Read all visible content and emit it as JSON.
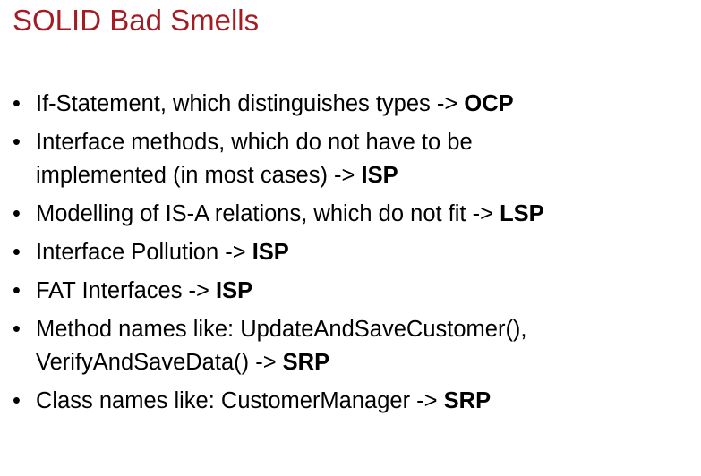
{
  "title": "SOLID Bad Smells",
  "title_color": "#a31c23",
  "bullet_icon": "bullet-dot",
  "items": [
    {
      "lines": [
        "If-Statement, which distinguishes types -> "
      ],
      "principle": "OCP"
    },
    {
      "lines": [
        "Interface methods, which do not have to be",
        "implemented (in most cases) -> "
      ],
      "principle": "ISP"
    },
    {
      "lines": [
        "Modelling of IS-A relations, which do not fit -> "
      ],
      "principle": "LSP"
    },
    {
      "lines": [
        "Interface Pollution -> "
      ],
      "principle": "ISP"
    },
    {
      "lines": [
        "FAT Interfaces -> "
      ],
      "principle": "ISP"
    },
    {
      "lines": [
        "Method names like: UpdateAndSaveCustomer(),",
        "VerifyAndSaveData() -> "
      ],
      "principle": "SRP"
    },
    {
      "lines": [
        "Class names like: CustomerManager -> "
      ],
      "principle": "SRP"
    }
  ]
}
